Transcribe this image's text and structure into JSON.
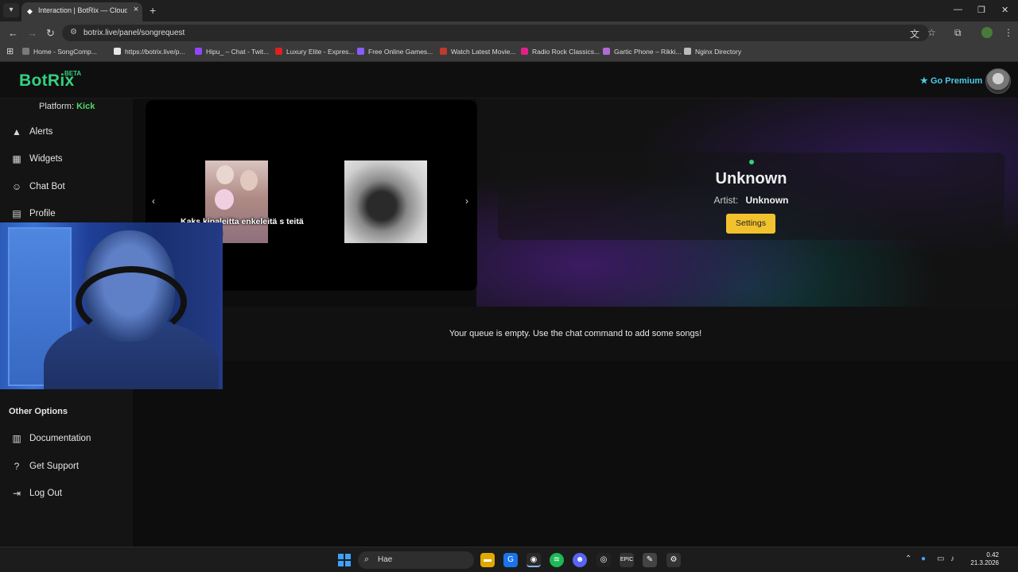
{
  "browser": {
    "tab_title": "Interaction | BotRix — Cloud St",
    "url": "botrix.live/panel/songrequest",
    "bookmarks": [
      {
        "label": "Home - SongComp...",
        "color": "#7a7a7a"
      },
      {
        "label": "https://botrix.live/p...",
        "color": "#e6e6e6"
      },
      {
        "label": "Hipu_ – Chat - Twit...",
        "color": "#9146ff"
      },
      {
        "label": "Luxury Elite - Expres...",
        "color": "#e02020"
      },
      {
        "label": "Free Online Games...",
        "color": "#8a5cff"
      },
      {
        "label": "Watch Latest Movie...",
        "color": "#c0392b"
      },
      {
        "label": "Radio Rock Classics...",
        "color": "#e0218a"
      },
      {
        "label": "Gartic Phone – Rikki...",
        "color": "#b06bd6"
      },
      {
        "label": "Nginx Directory",
        "color": "#bbbbbb"
      }
    ]
  },
  "header": {
    "logo": "BotRix",
    "beta": "BETA",
    "premium_label": "Go Premium"
  },
  "sidebar": {
    "platform_label": "Platform:",
    "platform_value": "Kick",
    "items": [
      {
        "label": "Alerts",
        "icon": "warning-icon"
      },
      {
        "label": "Widgets",
        "icon": "grid-icon"
      },
      {
        "label": "Chat Bot",
        "icon": "robot-icon"
      },
      {
        "label": "Profile",
        "icon": "id-card-icon"
      }
    ],
    "other_options_title": "Other Options",
    "other_items": [
      {
        "label": "Documentation",
        "icon": "book-icon"
      },
      {
        "label": "Get Support",
        "icon": "question-icon"
      },
      {
        "label": "Log Out",
        "icon": "logout-icon"
      }
    ]
  },
  "carousel": {
    "caption": "Kaks kipaleitta enkeleitä s teitä etten heitä"
  },
  "now_playing": {
    "title": "Unknown",
    "artist_label": "Artist:",
    "artist_value": "Unknown",
    "settings_label": "Settings",
    "status_color": "#35d07f"
  },
  "queue": {
    "empty_message": "Your queue is empty. Use the chat command to add some songs!"
  },
  "taskbar": {
    "search_label": "Hae",
    "time": "0.42",
    "date": "21.3.2026"
  }
}
